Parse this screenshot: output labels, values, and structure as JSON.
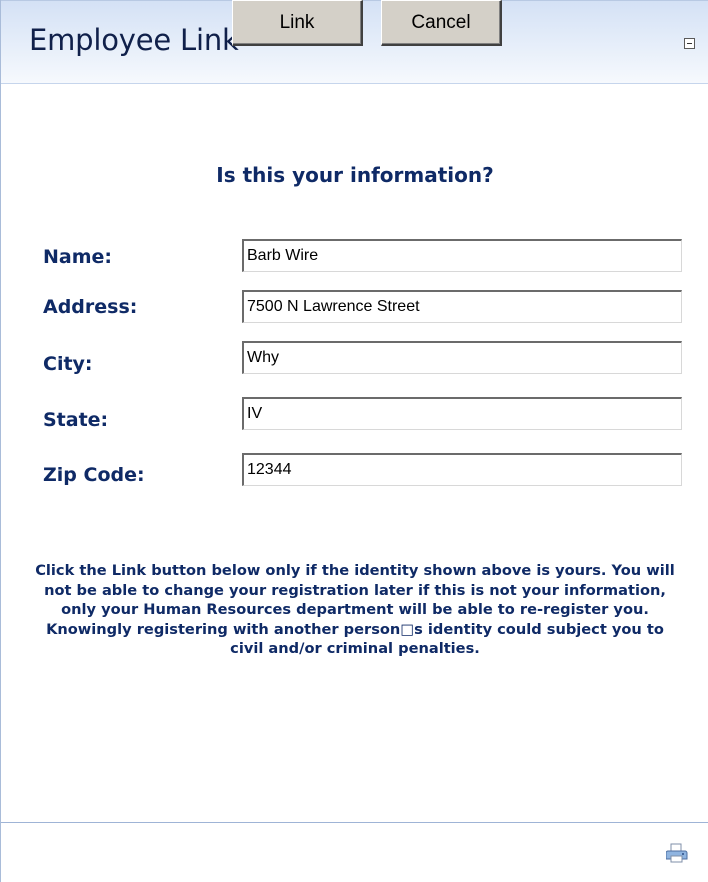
{
  "window": {
    "title": "Employee Link"
  },
  "form": {
    "question": "Is this your information?",
    "fields": [
      {
        "label": "Name:",
        "value": "Barb Wire"
      },
      {
        "label": "Address:",
        "value": "7500 N Lawrence Street"
      },
      {
        "label": "City:",
        "value": "Why"
      },
      {
        "label": "State:",
        "value": "IV"
      },
      {
        "label": "Zip Code:",
        "value": "12344"
      }
    ]
  },
  "notice": {
    "text": "Click the Link button below only if the identity shown above is yours. You will not be able to change your registration later if this is not your information, only your Human Resources department will be able to re-register you. Knowingly registering with another person□s identity could subject you to civil and/or criminal penalties."
  },
  "buttons": {
    "link_label": "Link",
    "cancel_label": "Cancel"
  },
  "icons": {
    "collapse": "collapse-icon",
    "print": "print-icon"
  },
  "colors": {
    "heading_text": "#0f2a66",
    "title_text": "#10204a",
    "titlebar_gradient_top": "#d4e1f5",
    "titlebar_gradient_bottom": "#f6f9fd",
    "button_face": "#d4d0c8",
    "divider": "#9fb4d6"
  }
}
